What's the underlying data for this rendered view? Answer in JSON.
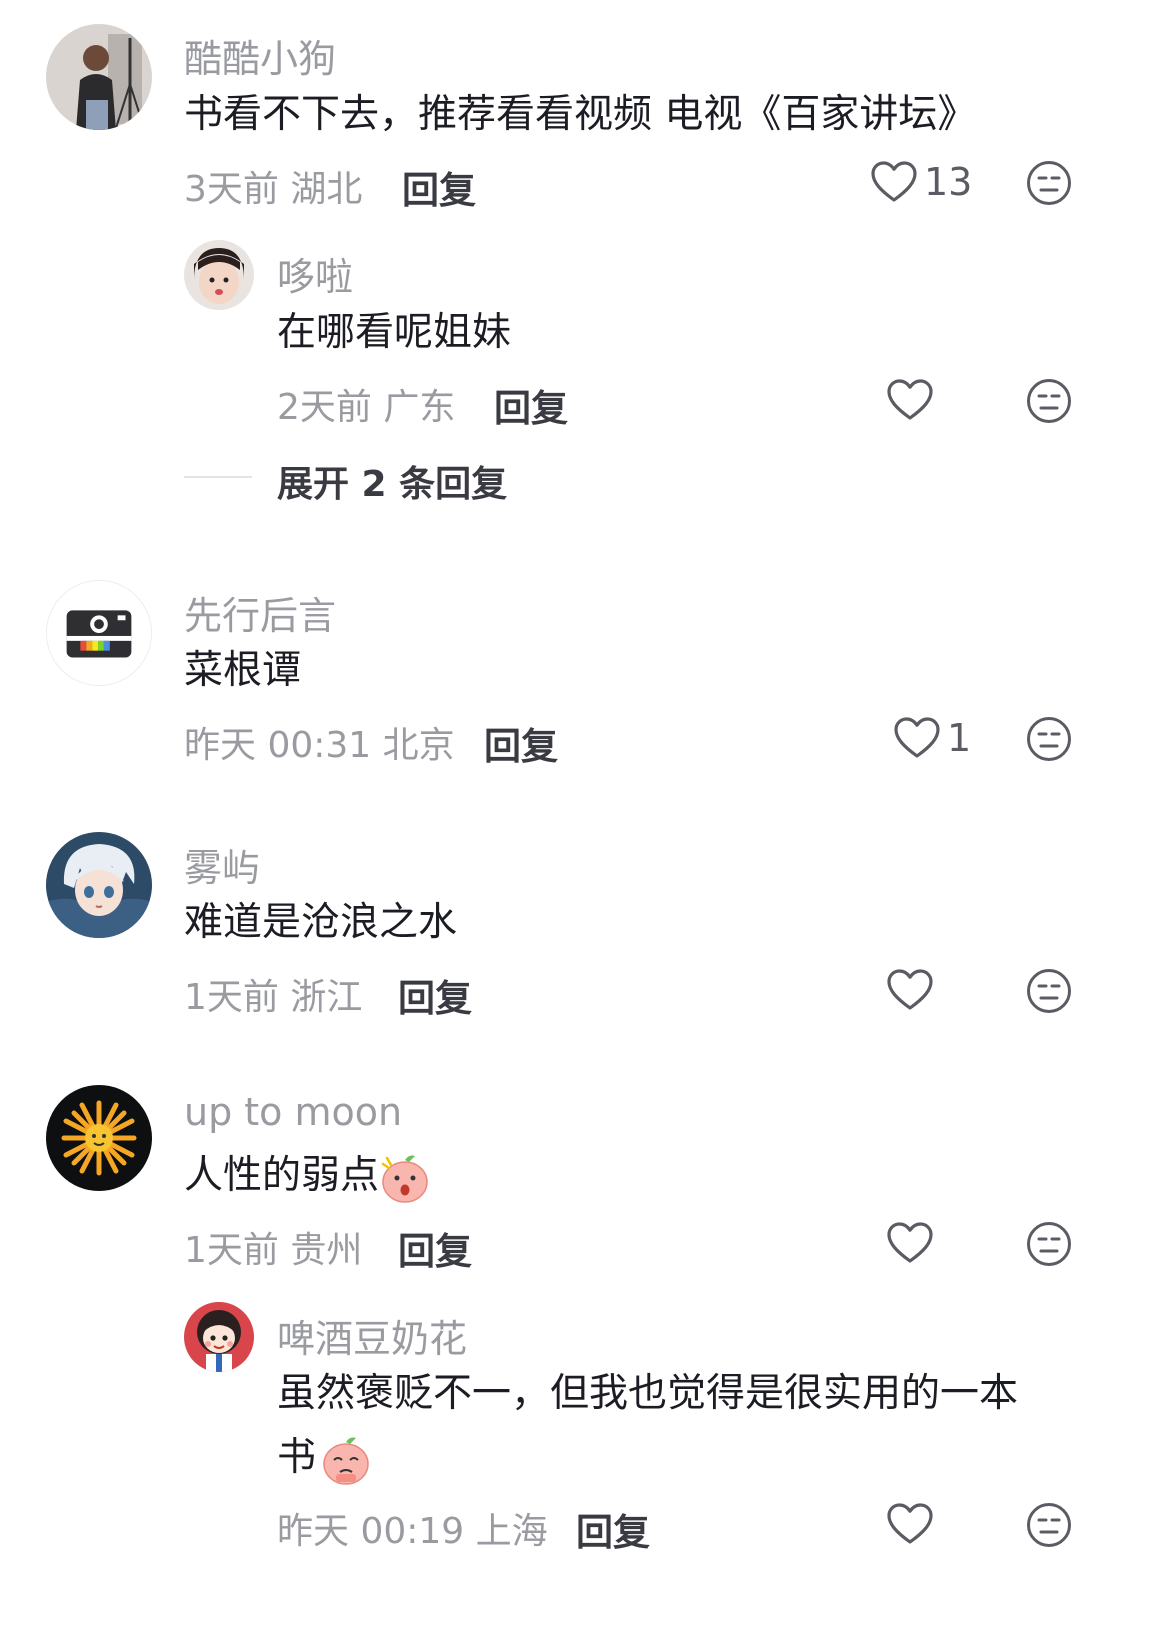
{
  "comments": [
    {
      "username": "酷酷小狗",
      "text": "书看不下去，推荐看看视频 电视《百家讲坛》",
      "meta": "3天前 湖北",
      "reply_label": "回复",
      "likes": "13",
      "avatar": "woman-photo-avatar",
      "replies": [
        {
          "username": "哆啦",
          "text": "在哪看呢姐妹",
          "meta": "2天前 广东",
          "reply_label": "回复",
          "avatar": "child-photo-avatar"
        }
      ],
      "expand_label": "展开 2 条回复"
    },
    {
      "username": "先行后言",
      "text": "菜根谭",
      "meta": "昨天 00:31 北京",
      "reply_label": "回复",
      "likes": "1",
      "avatar": "camera-avatar"
    },
    {
      "username": "雾屿",
      "text": "难道是沧浪之水",
      "meta": "1天前 浙江",
      "reply_label": "回复",
      "avatar": "anime-avatar"
    },
    {
      "username": "up to moon",
      "text": "人性的弱点",
      "meta": "1天前 贵州",
      "reply_label": "回复",
      "avatar": "sun-avatar",
      "emoji": "surprised-peach-emoji",
      "replies": [
        {
          "username": "啤酒豆奶花",
          "text_line1": "虽然褒贬不一，但我也觉得是很实用的一本",
          "text_line2": "书",
          "meta": "昨天 00:19 上海",
          "reply_label": "回复",
          "avatar": "cartoon-girl-avatar",
          "emoji": "pleading-peach-emoji"
        }
      ]
    }
  ],
  "colors": {
    "secondary_text": "#9a9ba1",
    "primary_text": "#1c1d24",
    "icon": "#5b5c63"
  }
}
